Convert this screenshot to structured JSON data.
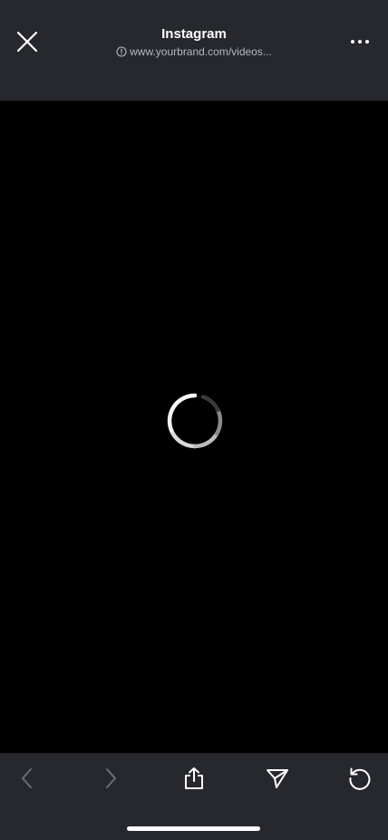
{
  "header": {
    "title": "Instagram",
    "url": "www.yourbrand.com/videos..."
  },
  "content": {
    "state": "loading"
  },
  "icons": {
    "close": "close-icon",
    "info": "info-icon",
    "more": "more-horizontal-icon",
    "back": "chevron-left-icon",
    "forward": "chevron-right-icon",
    "share": "share-icon",
    "send": "send-icon",
    "reload": "reload-icon"
  },
  "colors": {
    "bar_background": "#26282d",
    "content_background": "#000000",
    "text_primary": "#ffffff",
    "text_secondary": "#b5b8bd",
    "icon_disabled": "#6b6e73"
  }
}
